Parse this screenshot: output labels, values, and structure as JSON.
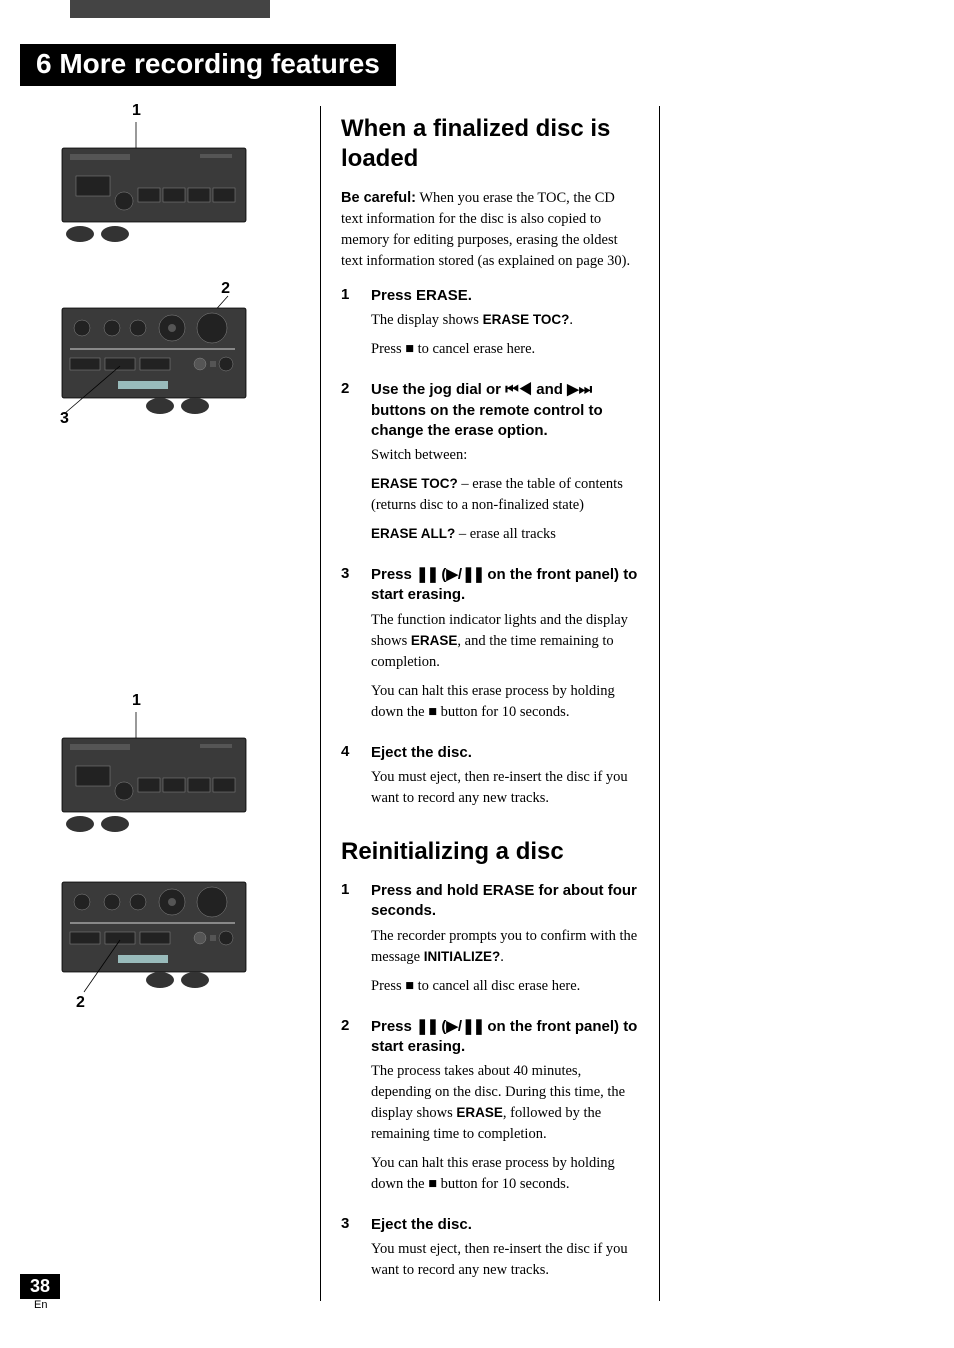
{
  "chapter": "6 More recording features",
  "section1": {
    "title": "When a finalized disc is loaded",
    "intro_bold": "Be careful:",
    "intro_rest": " When you erase the TOC, the CD text information for the disc is also copied to memory for editing purposes, erasing the oldest text information stored (as explained on page 30).",
    "steps": [
      {
        "num": "1",
        "head": "Press ERASE.",
        "p1_a": "The display shows ",
        "p1_b": "ERASE TOC?",
        "p1_c": ".",
        "p2_a": "Press ",
        "p2_b": " to cancel erase here."
      },
      {
        "num": "2",
        "head_a": "Use the jog dial or ",
        "head_b": " and ",
        "head_c": " buttons on the remote control to change the erase option.",
        "p1": "Switch between:",
        "p2_a": "ERASE TOC?",
        "p2_b": " – erase the table of contents (returns disc to a non-finalized state)",
        "p3_a": "ERASE ALL?",
        "p3_b": " – erase all tracks"
      },
      {
        "num": "3",
        "head_a": "Press ",
        "head_b": " (",
        "head_c": " on the front panel) to start erasing.",
        "p1_a": "The function indicator lights and the display shows ",
        "p1_b": "ERASE",
        "p1_c": ", and the time remaining to completion.",
        "p2_a": "You can halt this erase process by holding down the ",
        "p2_b": " button for 10 seconds."
      },
      {
        "num": "4",
        "head": "Eject the disc.",
        "p1": "You must eject, then re-insert the disc if you want to record any new tracks."
      }
    ]
  },
  "section2": {
    "title": "Reinitializing a disc",
    "steps": [
      {
        "num": "1",
        "head": "Press and hold ERASE for about four seconds.",
        "p1_a": "The recorder prompts you to confirm with the message ",
        "p1_b": "INITIALIZE?",
        "p1_c": ".",
        "p2_a": "Press ",
        "p2_b": " to cancel all disc erase here."
      },
      {
        "num": "2",
        "head_a": "Press ",
        "head_b": " (",
        "head_c": " on the front panel) to start erasing.",
        "p1_a": "The process takes about 40 minutes, depending on the disc. During this time, the display shows ",
        "p1_b": "ERASE",
        "p1_c": ", followed by the remaining time to completion.",
        "p2_a": "You can halt this erase process by holding down the ",
        "p2_b": " button for 10 seconds."
      },
      {
        "num": "3",
        "head": "Eject the disc.",
        "p1": "You must eject, then re-insert the disc if you want to record any new tracks."
      }
    ]
  },
  "diagrams": {
    "d1_callout": "1",
    "d2_callout1": "2",
    "d2_callout2": "3",
    "d3_callout": "1",
    "d4_callout": "2"
  },
  "pageNumber": "38",
  "pageLang": "En"
}
